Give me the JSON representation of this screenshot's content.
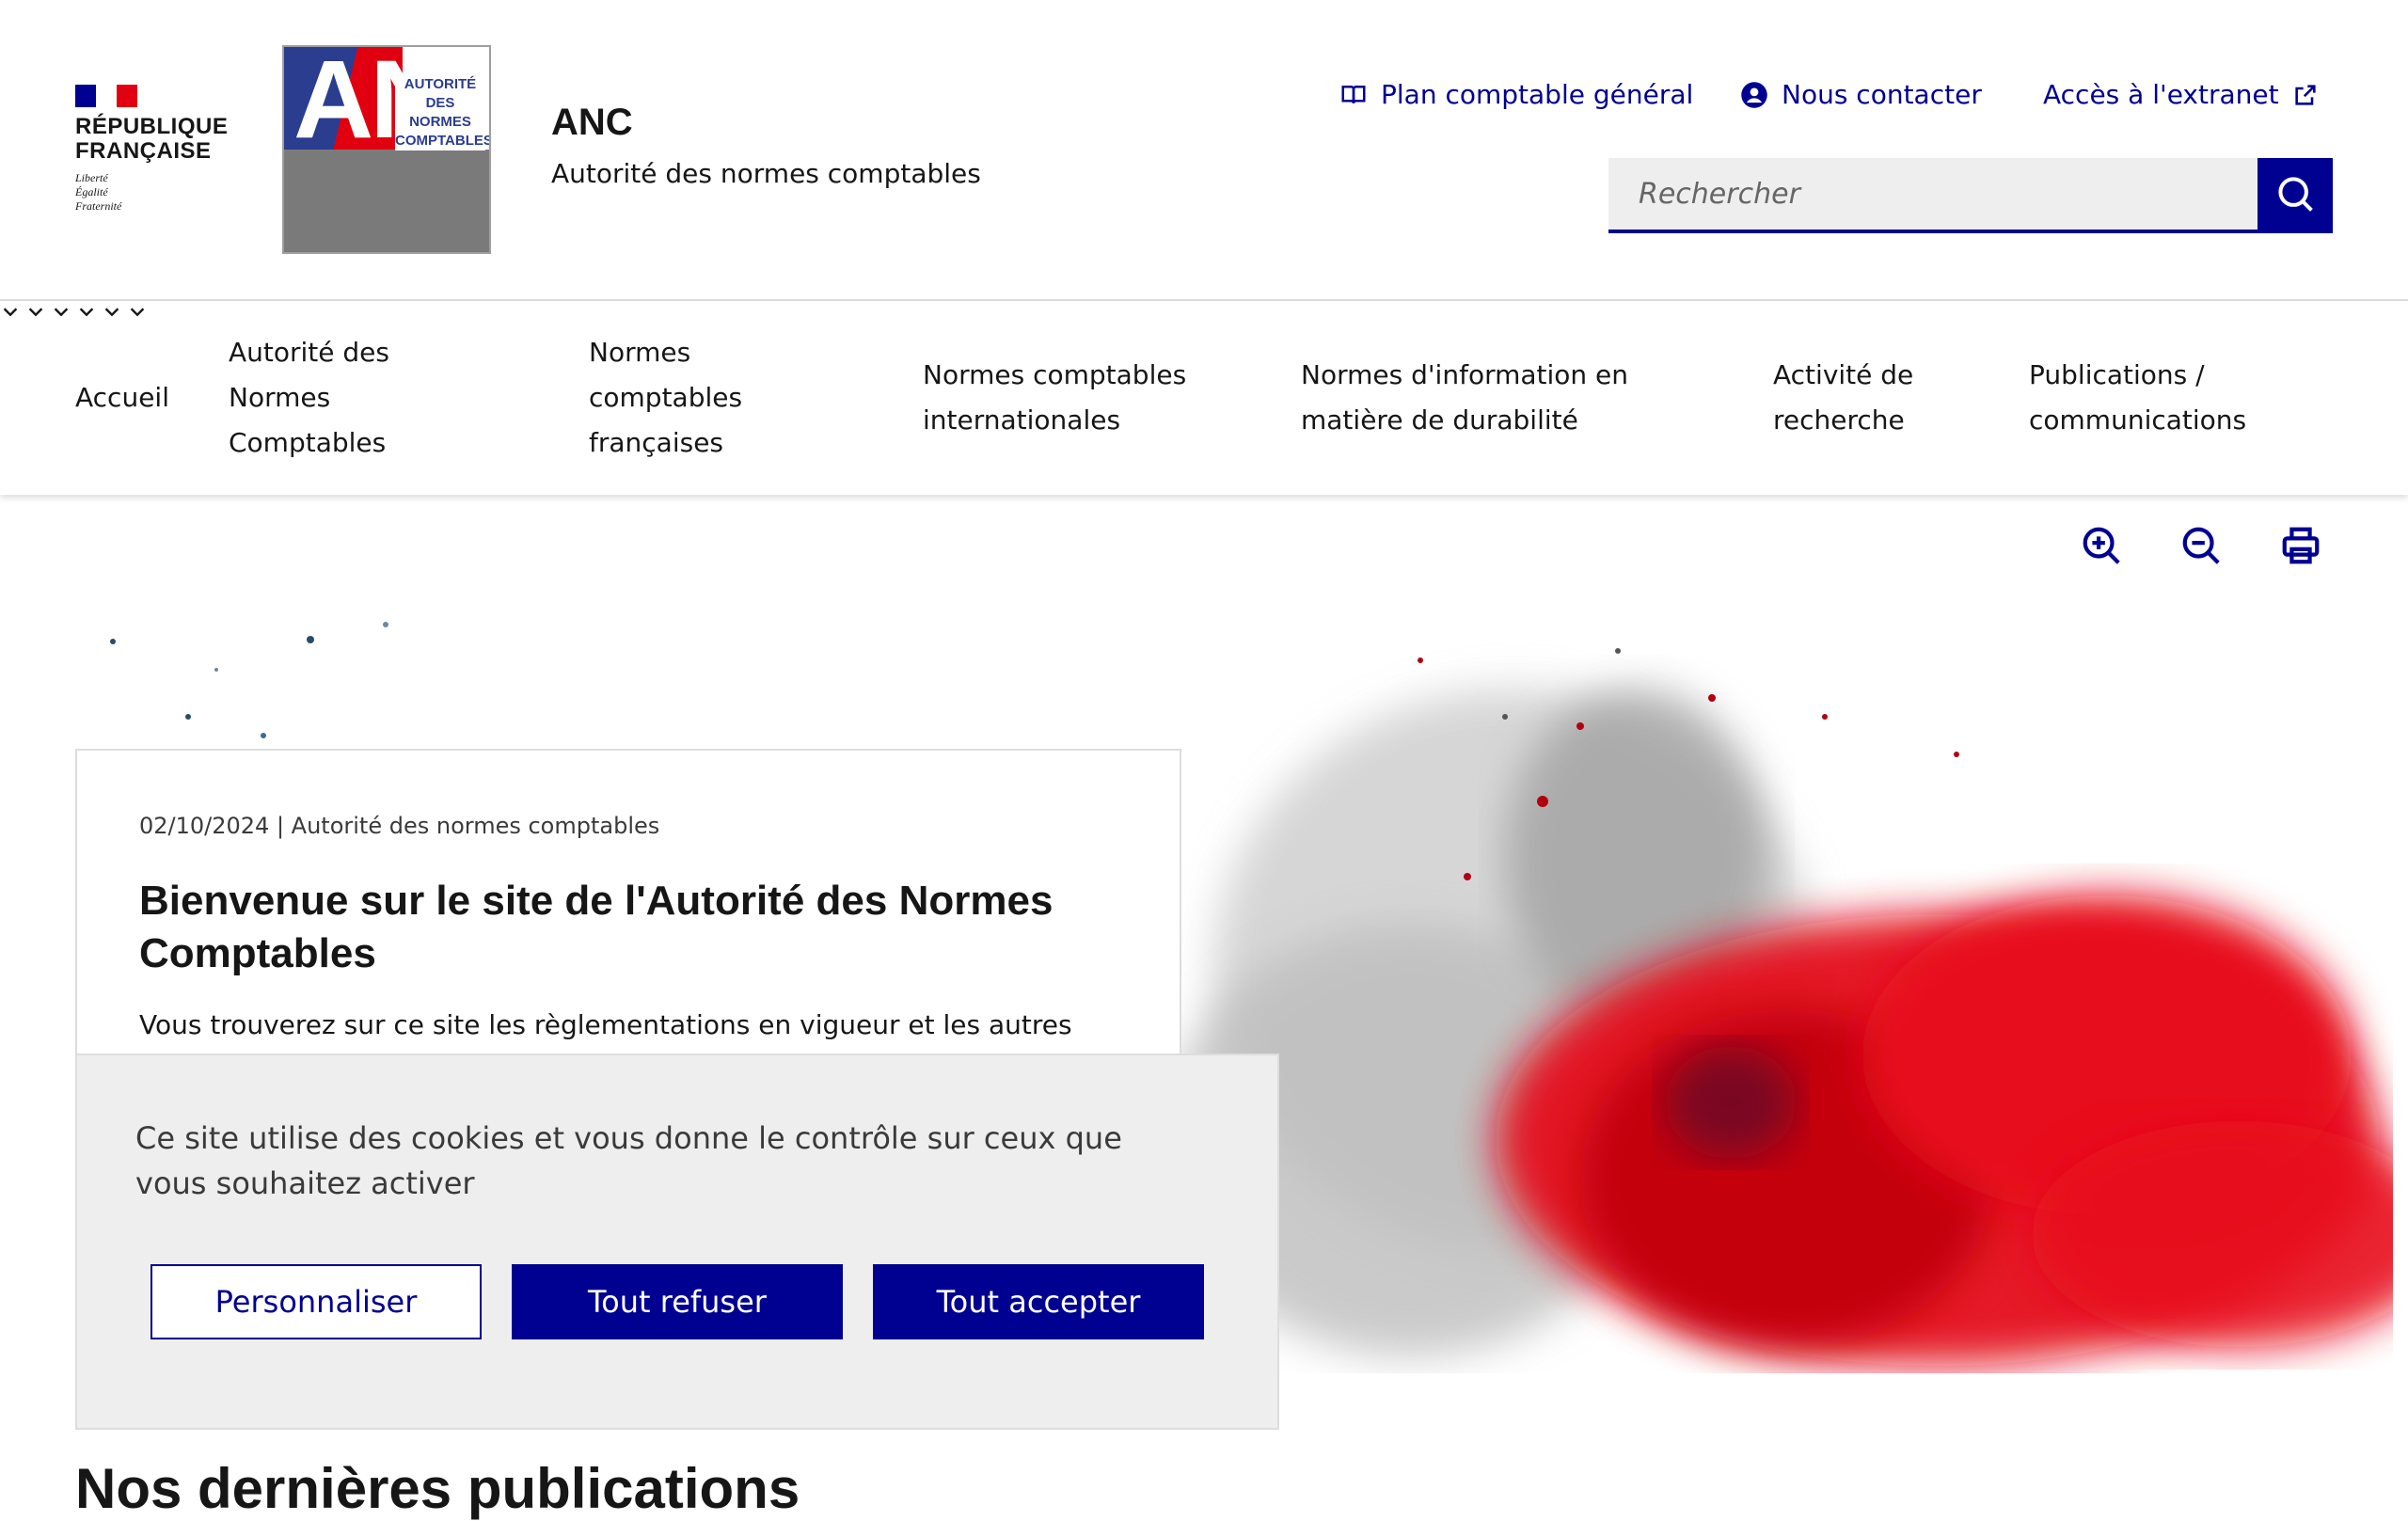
{
  "header": {
    "republique_line1": "RÉPUBLIQUE",
    "republique_line2": "FRANÇAISE",
    "motto_1": "Liberté",
    "motto_2": "Égalité",
    "motto_3": "Fraternité",
    "logo_letters": "ANC",
    "logo_tagline": "AUTORITÉ DES NORMES COMPTABLES",
    "site_name": "ANC",
    "site_tagline": "Autorité des normes comptables",
    "tools": {
      "plan_comptable": "Plan comptable général",
      "contact": "Nous contacter",
      "extranet": "Accès à l'extranet"
    },
    "search_placeholder": "Rechercher"
  },
  "nav": {
    "items": [
      {
        "label": "Accueil"
      },
      {
        "label": "Autorité des Normes Comptables"
      },
      {
        "label": "Normes comptables françaises"
      },
      {
        "label": "Normes comptables internationales"
      },
      {
        "label": "Normes d'information en matière de durabilité"
      },
      {
        "label": "Activité de recherche"
      },
      {
        "label": "Publications / communications"
      }
    ]
  },
  "hero_card": {
    "meta": "02/10/2024 | Autorité des normes comptables",
    "title": "Bienvenue sur le site de l'Autorité des Normes Comptables",
    "text": "Vous trouverez sur ce site les règlementations en vigueur et les autres"
  },
  "cookie_banner": {
    "message": "Ce site utilise des cookies et vous donne le contrôle sur ceux que vous souhaitez activer",
    "customize": "Personnaliser",
    "refuse_all": "Tout refuser",
    "accept_all": "Tout accepter"
  },
  "section": {
    "latest_publications": "Nos dernières publications"
  },
  "colors": {
    "primary_blue": "#000091",
    "marianne_red": "#e1000f",
    "text": "#161616",
    "grey_bg": "#eeeeee"
  },
  "icons": [
    "book-icon",
    "user-circle-icon",
    "external-link-icon",
    "search-icon",
    "chevron-down-icon",
    "zoom-in-icon",
    "zoom-out-icon",
    "print-icon"
  ]
}
